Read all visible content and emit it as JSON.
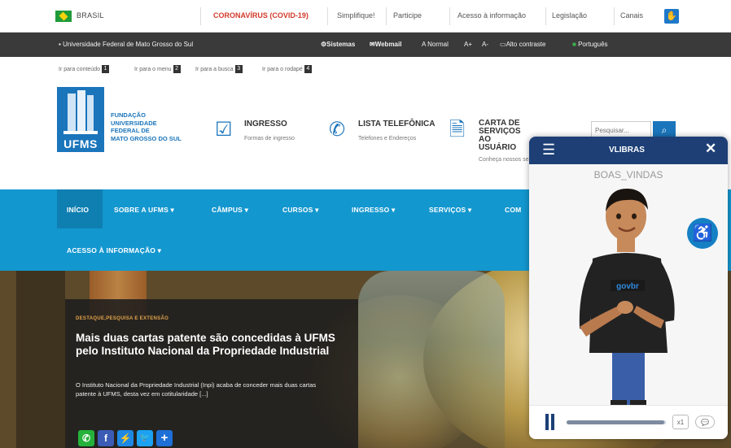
{
  "gov_bar": {
    "country": "BRASIL",
    "links": [
      "CORONAVÍRUS (COVID-19)",
      "Simplifique!",
      "Participe",
      "Acesso à informação",
      "Legislação",
      "Canais"
    ],
    "covid_color": "#d23a2b"
  },
  "access_bar": {
    "institution": "Universidade Federal de Mato Grosso do Sul",
    "items": [
      "Sistemas",
      "Webmail",
      "A Normal",
      "A+",
      "A-",
      "Alto contraste",
      "Português"
    ]
  },
  "skip_links": [
    {
      "label": "Ir para conteúdo",
      "key": "1"
    },
    {
      "label": "Ir para o menu",
      "key": "2"
    },
    {
      "label": "Ir para a busca",
      "key": "3"
    },
    {
      "label": "Ir para o rodapé",
      "key": "4"
    }
  ],
  "header": {
    "logo_acronym": "UFMS",
    "logo_name": "FUNDAÇÃO\nUNIVERSIDADE\nFEDERAL DE\nMATO GROSSO DO SUL",
    "quick_links": [
      {
        "title": "INGRESSO",
        "subtitle": "Formas de ingresso",
        "icon": "check-document-icon"
      },
      {
        "title": "LISTA TELEFÔNICA",
        "subtitle": "Telefones e Endereços",
        "icon": "phone-icon"
      },
      {
        "title": "CARTA DE\nSERVIÇOS AO\nUSUÁRIO",
        "subtitle": "Conheça nossos serv",
        "icon": "document-icon"
      }
    ],
    "search_placeholder": "Pesquisar...",
    "brand_color": "#1b75bb"
  },
  "nav": {
    "items": [
      "INÍCIO",
      "SOBRE A UFMS ▾",
      "CÂMPUS ▾",
      "CURSOS ▾",
      "INGRESSO ▾",
      "SERVIÇOS ▾",
      "COM",
      "ACESSO À INFORMAÇÃO ▾"
    ],
    "bg_color": "#1397cf"
  },
  "hero": {
    "kicker": "DESTAQUE,PESQUISA E EXTENSÃO",
    "headline": "Mais duas cartas patente são concedidas à UFMS pelo Instituto Nacional da Propriedade Industrial",
    "excerpt": "O Instituto Nacional da Propriedade Industrial (Inpi) acaba de conceder mais duas cartas patente à UFMS, desta vez em cotitularidade [...]",
    "share": [
      {
        "icon": "whatsapp-icon",
        "glyph": "✆",
        "color": "#25b23a"
      },
      {
        "icon": "facebook-icon",
        "glyph": "f",
        "color": "#3b5bb5"
      },
      {
        "icon": "messenger-icon",
        "glyph": "⚡",
        "color": "#1e88e5"
      },
      {
        "icon": "twitter-icon",
        "glyph": "🐦",
        "color": "#1da1f2"
      },
      {
        "icon": "share-plus-icon",
        "glyph": "+",
        "color": "#1e6fd6"
      }
    ]
  },
  "vlibras": {
    "title": "VLIBRAS",
    "gloss": "BOAS_VINDAS",
    "avatar_shirt_text": "govbr",
    "speed": "x1",
    "progress": 0.98,
    "header_color": "#1d3f76"
  }
}
